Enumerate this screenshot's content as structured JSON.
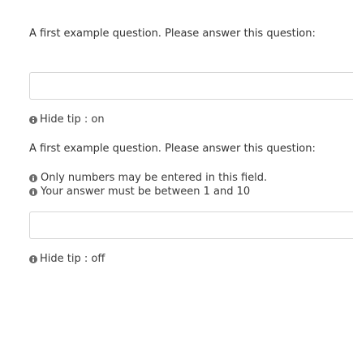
{
  "questions": [
    {
      "text": "A first example question. Please answer this question:",
      "answer_value": "",
      "hide_tip_label": "Hide tip : on",
      "tips": []
    },
    {
      "text": "A first example question. Please answer this question:",
      "answer_value": "",
      "hide_tip_label": "Hide tip : off",
      "tips": [
        "Only numbers may be entered in this field.",
        "Your answer must be between 1 and 10"
      ]
    }
  ],
  "icons": {
    "tip_icon": "info-icon",
    "hide_tip_icon": "info-icon"
  }
}
